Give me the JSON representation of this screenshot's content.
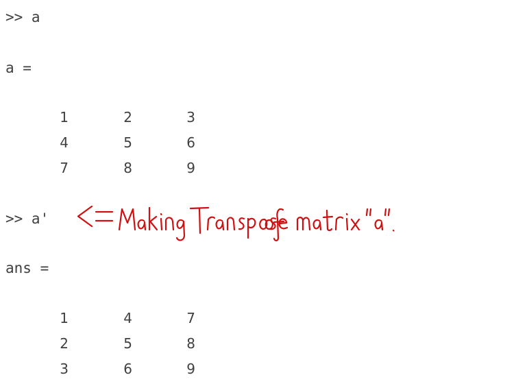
{
  "console": {
    "cmd1": ">> a",
    "out1_header": "a =",
    "matrix_a": [
      [
        "1",
        "2",
        "3"
      ],
      [
        "4",
        "5",
        "6"
      ],
      [
        "7",
        "8",
        "9"
      ]
    ],
    "cmd2": ">> a'",
    "out2_header": "ans =",
    "matrix_ans": [
      [
        "1",
        "4",
        "7"
      ],
      [
        "2",
        "5",
        "8"
      ],
      [
        "3",
        "6",
        "9"
      ]
    ]
  },
  "annotation": {
    "text": "Making Transpose of matrix \"a\".",
    "color": "#d01010",
    "icon": "double-left-arrow-icon"
  }
}
